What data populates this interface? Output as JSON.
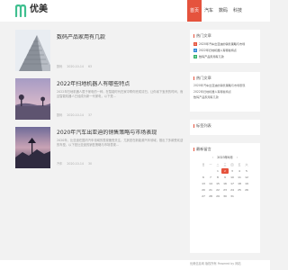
{
  "header": {
    "site_name": "优美",
    "nav": [
      "首页",
      "汽车",
      "数码",
      "科技"
    ]
  },
  "posts": [
    {
      "title": "数码产品家用有几款",
      "excerpt": "",
      "meta": [
        "数码",
        "2020-10-14",
        "63"
      ],
      "scene": "building"
    },
    {
      "title": "2022年扫地机器人有哪些特点",
      "excerpt": "2022年扫地机器人属于家电的一种，在智能时代在家中帮你完成清扫，让你省下宝贵的时间，而且智能机器人已经成为新一代家电，以下是…",
      "meta": [
        "数码",
        "2020-10-14",
        "37"
      ],
      "scene": "field"
    },
    {
      "title": "2020年汽车出亚迪的销售策略与市场表现",
      "excerpt": "2020年，比亚迪在国内汽车领域的表现备受关注，尤其是在新能源汽车领域，推出了多款受欢迎的车型，以下是比亚迪的销售策略与市场表现…",
      "meta": [
        "汽车",
        "2020-10-14",
        "30"
      ],
      "scene": "dusk"
    }
  ],
  "sidebar": {
    "hot_title": "热门文章",
    "hot": [
      {
        "num": "1",
        "label": "2020年汽车出亚迪的销售策略与市场",
        "color": "#e5533d"
      },
      {
        "num": "2",
        "label": "2022年扫地机器人有哪些特点",
        "color": "#2f88d6"
      },
      {
        "num": "3",
        "label": "数码产品家用有几款",
        "color": "#35b36a"
      }
    ],
    "recommend_title": "热门文章",
    "recommend": [
      "2020年汽车出亚迪的销售策略与市场表现",
      "2022年扫地机器人有哪些特点",
      "数码产品家用有几款"
    ],
    "tags_title": "标签列表",
    "calendar_title": "最新留言",
    "calendar": {
      "month": "2023年8月",
      "weekdays": [
        "日",
        "一",
        "二",
        "三",
        "四",
        "五",
        "六"
      ],
      "days": [
        "",
        "",
        "1",
        "2",
        "3",
        "4",
        "5",
        "6",
        "7",
        "8",
        "9",
        "10",
        "11",
        "12",
        "13",
        "14",
        "15",
        "16",
        "17",
        "18",
        "19",
        "20",
        "21",
        "22",
        "23",
        "24",
        "25",
        "26",
        "27",
        "28",
        "29",
        "30",
        "31",
        "",
        ""
      ],
      "today": "2"
    }
  },
  "footer": {
    "text": "优美信息网 版权所有 Powered by 网站"
  }
}
